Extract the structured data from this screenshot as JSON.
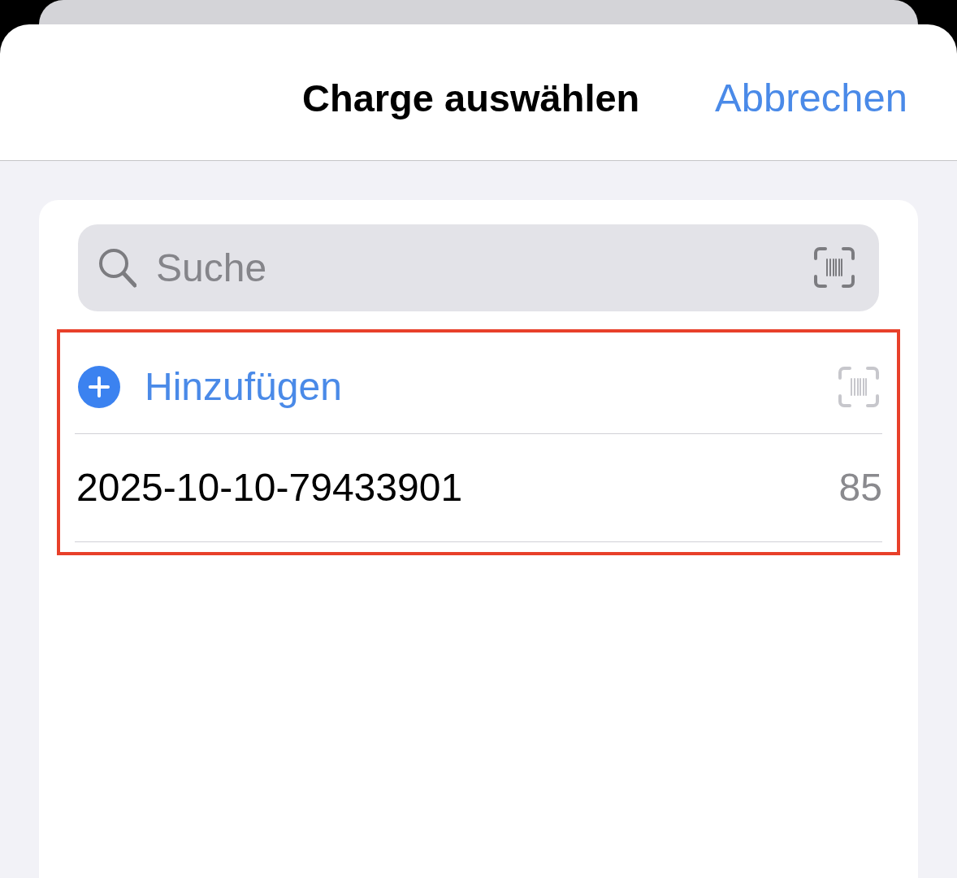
{
  "header": {
    "title": "Charge auswählen",
    "cancel": "Abbrechen"
  },
  "search": {
    "placeholder": "Suche"
  },
  "list": {
    "highlighted": true,
    "add_row": {
      "label": "Hinzufügen",
      "scan_disabled": true
    },
    "items": [
      {
        "name": "2025-10-10-79433901",
        "count": "85"
      }
    ]
  }
}
